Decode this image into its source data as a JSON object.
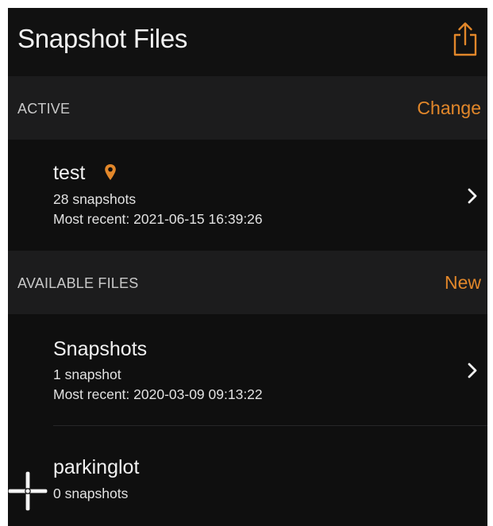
{
  "nav": {
    "title": "Snapshot Files",
    "share_icon": "share-icon"
  },
  "active_section": {
    "title": "ACTIVE",
    "action": "Change",
    "file": {
      "name": "test",
      "marker_icon": "location-pin-icon",
      "count": "28 snapshots",
      "recent": "Most recent: 2021-06-15 16:39:26"
    }
  },
  "available_section": {
    "title": "AVAILABLE FILES",
    "action": "New",
    "files": [
      {
        "name": "Snapshots",
        "count": "1 snapshot",
        "recent": "Most recent: 2020-03-09 09:13:22"
      },
      {
        "name": "parkinglot",
        "count": "0 snapshots"
      }
    ]
  },
  "colors": {
    "accent": "#e2872a",
    "background": "#0f0f0f",
    "section_header": "#1c1c1d",
    "text": "#f2f2f2"
  }
}
